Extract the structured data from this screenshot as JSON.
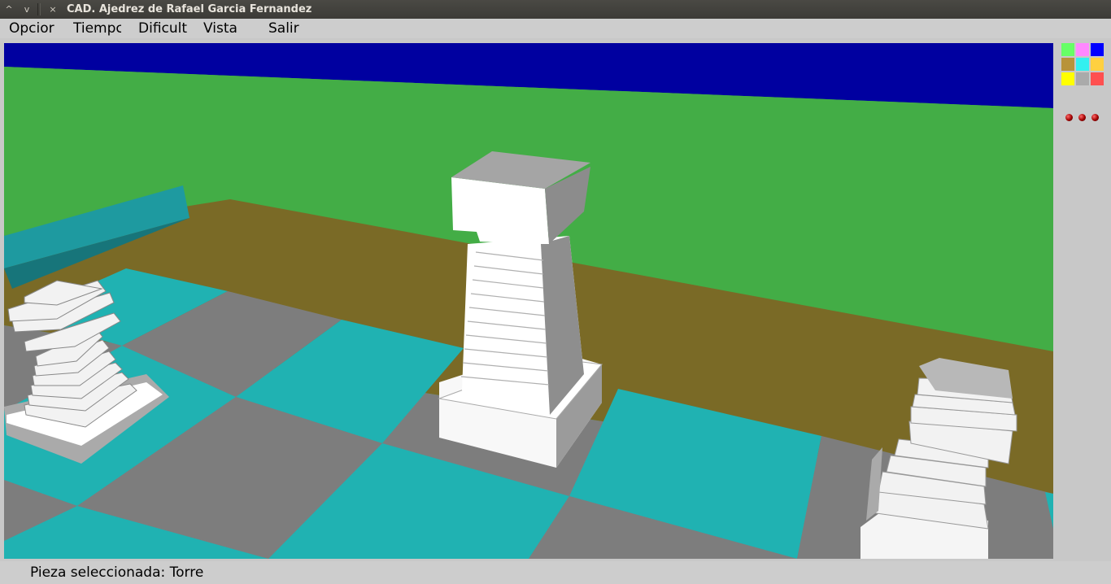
{
  "window": {
    "title": "CAD. Ajedrez de Rafael Garcia Fernandez",
    "controls": [
      "^",
      "v",
      "×"
    ]
  },
  "menu": {
    "items": [
      "Opcior",
      "Tiempc",
      "Dificult",
      "Vista",
      "Salir"
    ]
  },
  "palette": {
    "colors": [
      "#66ff66",
      "#ff88ff",
      "#0000ff",
      "#b8933a",
      "#33f0f0",
      "#ffd040",
      "#ffff00",
      "#aaaaaa",
      "#ff5050"
    ]
  },
  "indicators": {
    "count": 3,
    "color": "#c00000"
  },
  "status": {
    "text": "Pieza seleccionada: Torre"
  }
}
